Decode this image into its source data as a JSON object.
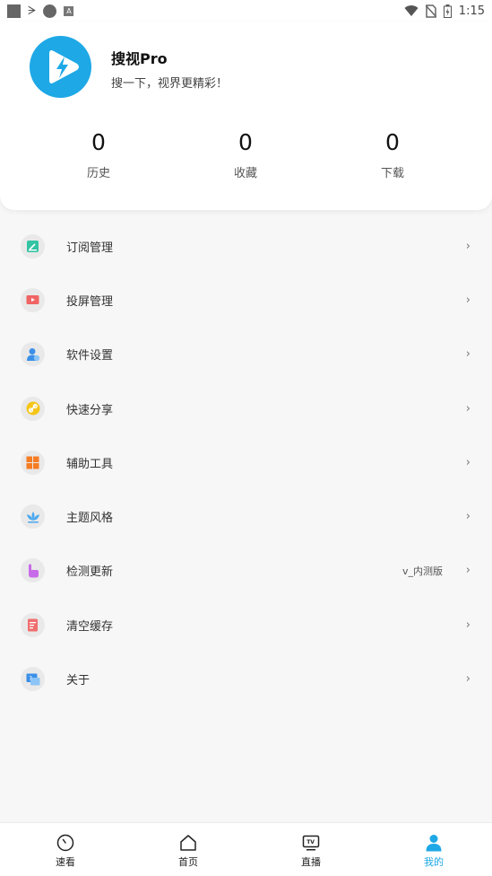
{
  "status_bar": {
    "left_icons": [
      "square-icon",
      "bug-icon",
      "infinity-icon",
      "a-icon"
    ],
    "right_icons": [
      "wifi-icon",
      "no-sim-icon",
      "battery-icon"
    ],
    "time": "1:15"
  },
  "profile": {
    "app_name": "搜视Pro",
    "slogan": "搜一下，视界更精彩！",
    "avatar_icon": "play-bolt-icon",
    "avatar_color": "#1ea8e6"
  },
  "stats": [
    {
      "value": "0",
      "label": "历史"
    },
    {
      "value": "0",
      "label": "收藏"
    },
    {
      "value": "0",
      "label": "下载"
    }
  ],
  "menu": [
    {
      "label": "订阅管理",
      "icon": "subscribe-icon",
      "value": ""
    },
    {
      "label": "投屏管理",
      "icon": "cast-icon",
      "value": ""
    },
    {
      "label": "软件设置",
      "icon": "user-settings-icon",
      "value": ""
    },
    {
      "label": "快速分享",
      "icon": "link-share-icon",
      "value": ""
    },
    {
      "label": "辅助工具",
      "icon": "grid-tools-icon",
      "value": ""
    },
    {
      "label": "主题风格",
      "icon": "lotus-theme-icon",
      "value": ""
    },
    {
      "label": "检测更新",
      "icon": "tap-update-icon",
      "value": "v_内测版"
    },
    {
      "label": "清空缓存",
      "icon": "clear-cache-icon",
      "value": ""
    },
    {
      "label": "关于",
      "icon": "about-icon",
      "value": ""
    }
  ],
  "chevron": "›",
  "bottom_nav": [
    {
      "label": "速看",
      "icon": "clock-icon"
    },
    {
      "label": "首页",
      "icon": "home-icon"
    },
    {
      "label": "直播",
      "icon": "tv-icon"
    },
    {
      "label": "我的",
      "icon": "user-icon",
      "active": true
    }
  ],
  "colors": {
    "accent": "#1ea8e6",
    "background": "#f7f7f7"
  }
}
